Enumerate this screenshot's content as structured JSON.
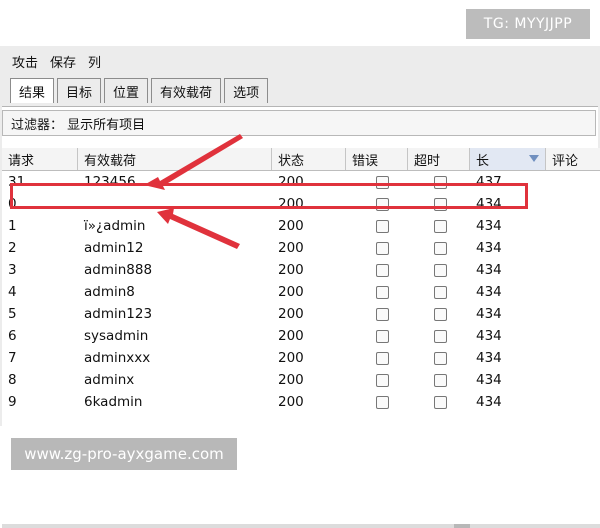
{
  "menu": [
    "攻击",
    "保存",
    "列"
  ],
  "tabs": [
    "结果",
    "目标",
    "位置",
    "有效载荷",
    "选项"
  ],
  "active_tab_index": 0,
  "filter_text": "过滤器： 显示所有项目",
  "columns": [
    "请求",
    "有效载荷",
    "状态",
    "错误",
    "超时",
    "长",
    "评论"
  ],
  "sorted_column": "长",
  "rows": [
    {
      "request": "31",
      "payload": "123456",
      "status": "200",
      "length": "437"
    },
    {
      "request": "0",
      "payload": "",
      "status": "200",
      "length": "434"
    },
    {
      "request": "1",
      "payload": "ï»¿admin",
      "status": "200",
      "length": "434"
    },
    {
      "request": "2",
      "payload": "admin12",
      "status": "200",
      "length": "434"
    },
    {
      "request": "3",
      "payload": "admin888",
      "status": "200",
      "length": "434"
    },
    {
      "request": "4",
      "payload": "admin8",
      "status": "200",
      "length": "434"
    },
    {
      "request": "5",
      "payload": "admin123",
      "status": "200",
      "length": "434"
    },
    {
      "request": "6",
      "payload": "sysadmin",
      "status": "200",
      "length": "434"
    },
    {
      "request": "7",
      "payload": "adminxxx",
      "status": "200",
      "length": "434"
    },
    {
      "request": "8",
      "payload": "adminx",
      "status": "200",
      "length": "434"
    },
    {
      "request": "9",
      "payload": "6kadmin",
      "status": "200",
      "length": "434"
    }
  ],
  "watermark_top": "TG: MYYJJPP",
  "watermark_bottom": "www.zg-pro-ayxgame.com",
  "colors": {
    "highlight": "#e0323c",
    "arrow": "#e0323c",
    "watermark": "#bcbcbc"
  }
}
